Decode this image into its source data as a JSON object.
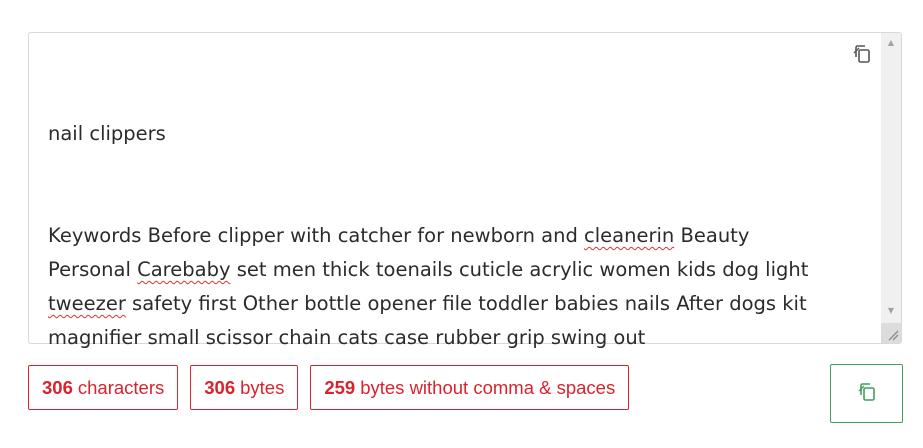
{
  "editor": {
    "first_line": "nail clippers",
    "paragraph": [
      {
        "text": "Keywords Before clipper with catcher for newborn and ",
        "misspelled": false
      },
      {
        "text": "cleanerin",
        "misspelled": true
      },
      {
        "text": " Beauty Personal ",
        "misspelled": false
      },
      {
        "text": "Carebaby",
        "misspelled": true
      },
      {
        "text": " set men thick toenails cuticle acrylic women kids dog light ",
        "misspelled": false
      },
      {
        "text": "tweezer",
        "misspelled": true
      },
      {
        "text": " safety first Other bottle opener file toddler babies nails After dogs kit magnifier small scissor chain cats case rubber grip swing out",
        "misspelled": false
      }
    ],
    "copy_icon": "copy-icon",
    "scroll_up_glyph": "▲",
    "scroll_down_glyph": "▼"
  },
  "stats": [
    {
      "value": "306",
      "label": "characters"
    },
    {
      "value": "306",
      "label": "bytes"
    },
    {
      "value": "259",
      "label": "bytes without comma & spaces"
    }
  ],
  "copy_button": {
    "icon": "copy-icon"
  },
  "colors": {
    "stat_accent": "#d9232d",
    "copy_button_border": "#3fa15c",
    "text": "#2b2b2b",
    "misspelling_underline": "#dd3333"
  }
}
